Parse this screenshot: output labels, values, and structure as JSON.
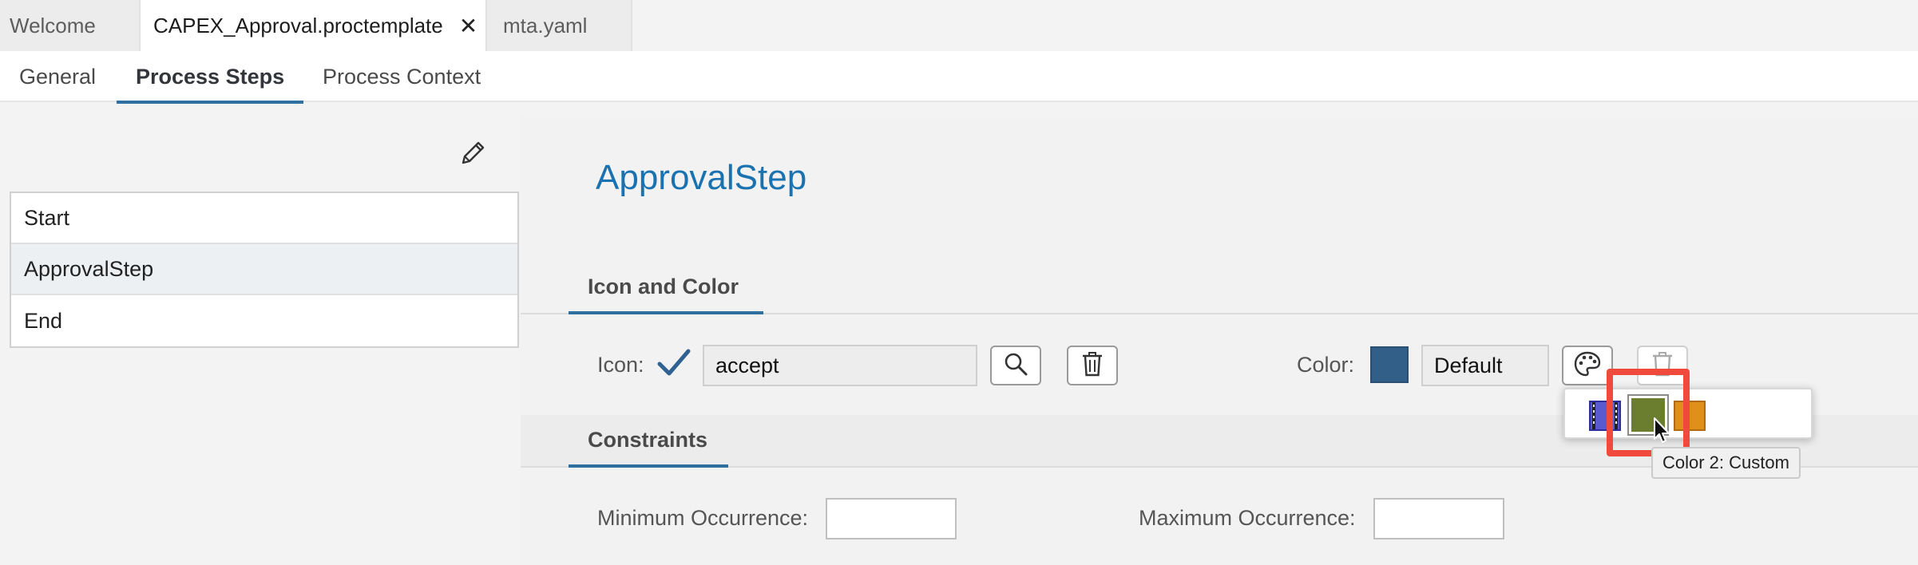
{
  "editor_tabs": [
    {
      "label": "Welcome",
      "active": false
    },
    {
      "label": "CAPEX_Approval.proctemplate",
      "active": true,
      "close": "✕"
    },
    {
      "label": "mta.yaml",
      "active": false
    }
  ],
  "sub_tabs": [
    {
      "label": "General",
      "active": false
    },
    {
      "label": "Process Steps",
      "active": true
    },
    {
      "label": "Process Context",
      "active": false
    }
  ],
  "steps": [
    "Start",
    "ApprovalStep",
    "End"
  ],
  "selected_step": "ApprovalStep",
  "detail": {
    "title": "ApprovalStep",
    "icon_section": {
      "heading": "Icon and Color",
      "icon_label": "Icon:",
      "icon_value": "accept",
      "icon_glyph": "checkmark-icon",
      "color_label": "Color:",
      "color_value": "Default",
      "selected_color": "#325f88"
    },
    "constraints_section": {
      "heading": "Constraints",
      "min_label": "Minimum Occurrence:",
      "min_value": "",
      "max_label": "Maximum Occurrence:",
      "max_value": ""
    }
  },
  "color_popover": {
    "chips": [
      {
        "name": "color-1",
        "color": "#5a5ad0"
      },
      {
        "name": "color-2-custom",
        "color": "#6b7d2e"
      },
      {
        "name": "color-3",
        "color": "#e0901a"
      }
    ],
    "tooltip": "Color 2: Custom"
  },
  "colors": {
    "accent": "#3070a0",
    "title": "#1a72b0",
    "highlight": "#ef4a3c"
  }
}
